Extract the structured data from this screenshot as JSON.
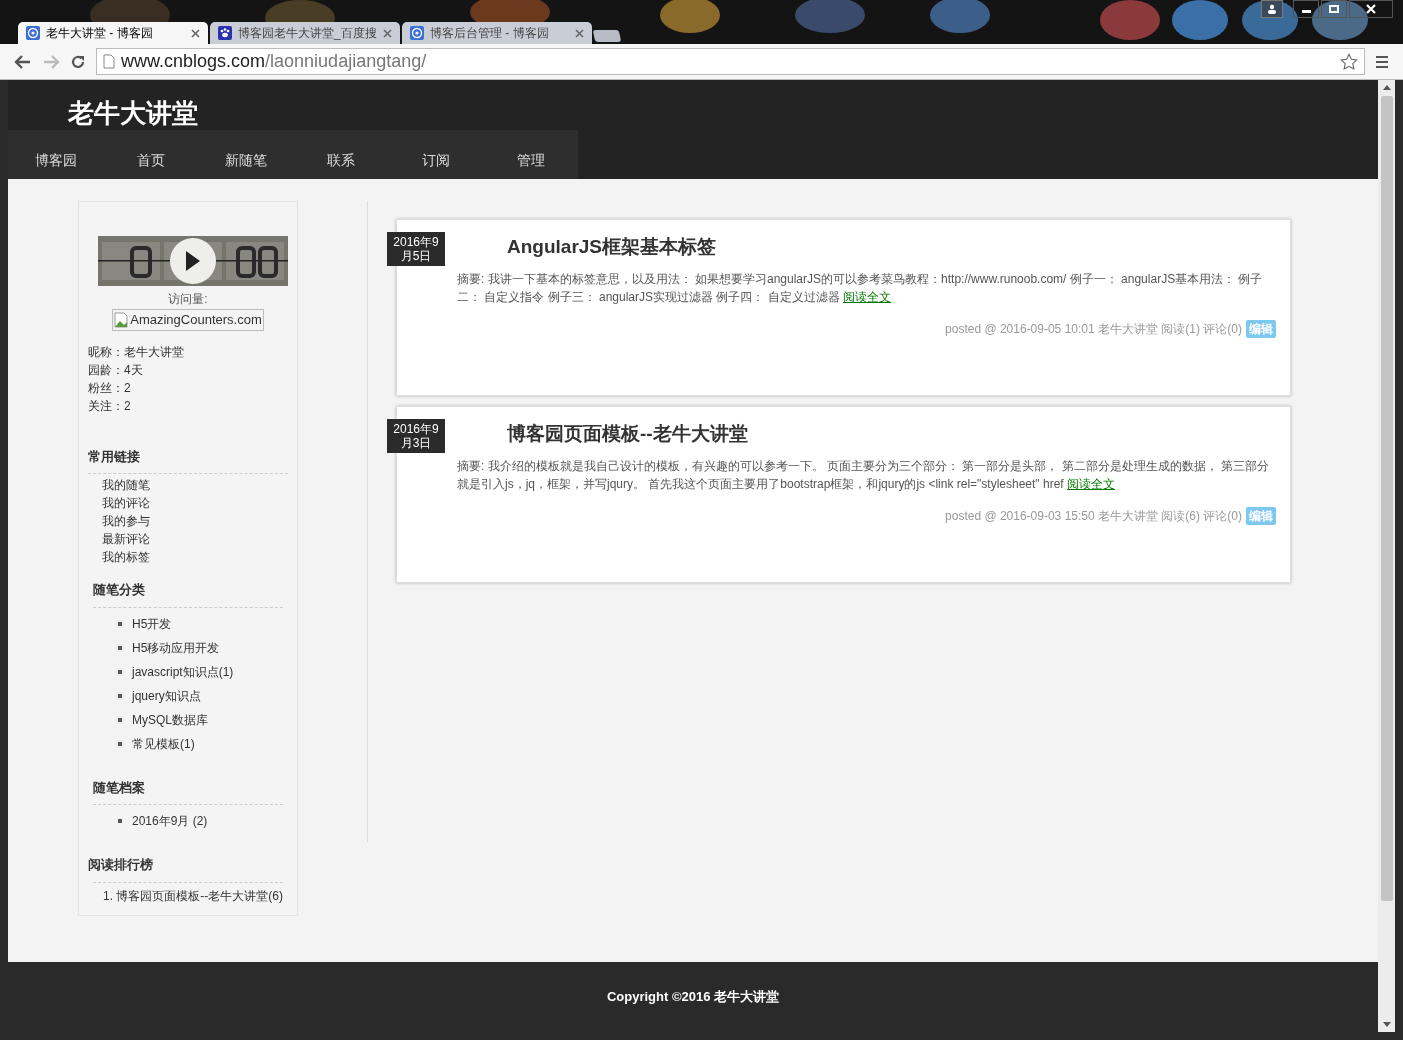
{
  "browser": {
    "tabs": [
      {
        "title": "老牛大讲堂 - 博客园",
        "kind": "swirl",
        "selected": true
      },
      {
        "title": "博客园老牛大讲堂_百度搜",
        "kind": "paw",
        "selected": false
      },
      {
        "title": "博客后台管理 - 博客园",
        "kind": "swirl",
        "selected": false
      }
    ],
    "url_host": "www.cnblogs.com",
    "url_path": "/laonniudajiangtang/"
  },
  "site": {
    "title": "老牛大讲堂",
    "nav": [
      "博客园",
      "首页",
      "新随笔",
      "联系",
      "订阅",
      "管理"
    ]
  },
  "sidebar": {
    "counter_label": "访问量:",
    "counter_alt": "AmazingCounters.com",
    "profile": [
      "昵称：老牛大讲堂",
      "园龄：4天",
      "粉丝：2",
      "关注：2"
    ],
    "sections": [
      {
        "title": "常用链接",
        "kind": "plain",
        "items": [
          "我的随笔",
          "我的评论",
          "我的参与",
          "最新评论",
          "我的标签"
        ]
      },
      {
        "title": "随笔分类",
        "kind": "bullet",
        "items": [
          "H5开发",
          "H5移动应用开发",
          "javascript知识点(1)",
          "jquery知识点",
          "MySQL数据库",
          "常见模板(1)"
        ]
      },
      {
        "title": "随笔档案",
        "kind": "bullet",
        "items": [
          "2016年9月 (2)"
        ]
      },
      {
        "title": "阅读排行榜",
        "kind": "numbered",
        "items": [
          "1. 博客园页面模板--老牛大讲堂(6)"
        ]
      }
    ]
  },
  "posts": [
    {
      "date": "2016年9月5日",
      "title": "AngularJS框架基本标签",
      "summary": "摘要: 我讲一下基本的标签意思，以及用法： 如果想要学习angularJS的可以参考菜鸟教程：http://www.runoob.com/ 例子一： angularJS基本用法： 例子二： 自定义指令 例子三： angularJS实现过滤器 例子四： 自定义过滤器",
      "more": "阅读全文",
      "meta": "posted @ 2016-09-05 10:01 老牛大讲堂 阅读(1) 评论(0)",
      "edit": "编辑"
    },
    {
      "date": "2016年9月3日",
      "title": "博客园页面模板--老牛大讲堂",
      "summary": "摘要: 我介绍的模板就是我自己设计的模板，有兴趣的可以参考一下。 页面主要分为三个部分： 第一部分是头部， 第二部分是处理生成的数据， 第三部分就是引入js，jq，框架，并写jqury。 首先我这个页面主要用了bootstrap框架，和jqury的js <link rel=\"stylesheet\" href",
      "more": "阅读全文",
      "meta": "posted @ 2016-09-03 15:50 老牛大讲堂 阅读(6) 评论(0)",
      "edit": "编辑"
    }
  ],
  "footer": "Copyright ©2016 老牛大讲堂"
}
